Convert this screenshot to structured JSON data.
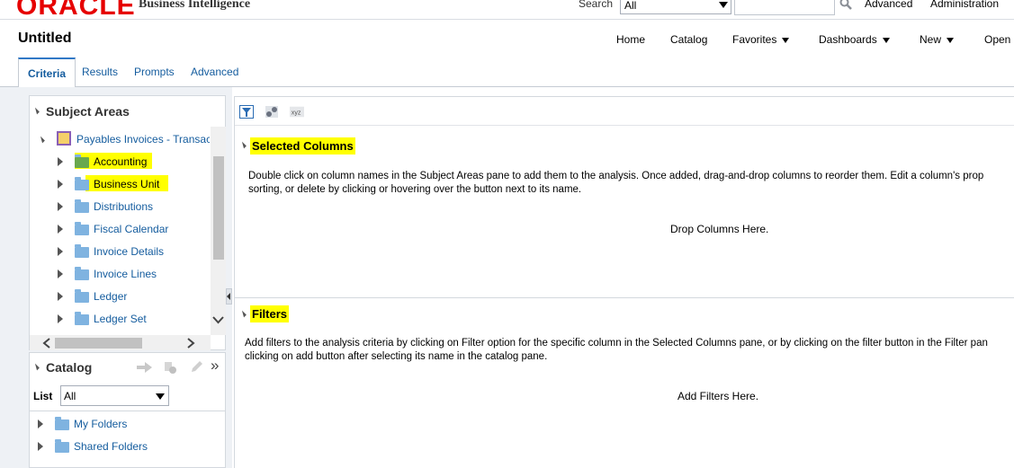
{
  "header": {
    "logo": "ORACLE",
    "product": "Business Intelligence",
    "search_label": "Search",
    "search_scope": "All",
    "search_value": "",
    "links": [
      "Advanced",
      "Administration"
    ]
  },
  "titlebar": {
    "title": "Untitled",
    "nav": [
      {
        "label": "Home",
        "dropdown": false
      },
      {
        "label": "Catalog",
        "dropdown": false
      },
      {
        "label": "Favorites",
        "dropdown": true
      },
      {
        "label": "Dashboards",
        "dropdown": true
      },
      {
        "label": "New",
        "dropdown": true
      },
      {
        "label": "Open",
        "dropdown": false
      }
    ]
  },
  "tabs": [
    {
      "label": "Criteria",
      "active": true
    },
    {
      "label": "Results",
      "active": false
    },
    {
      "label": "Prompts",
      "active": false
    },
    {
      "label": "Advanced",
      "active": false
    }
  ],
  "subject_areas": {
    "title": "Subject Areas",
    "root": "Payables Invoices - Transac",
    "items": [
      {
        "label": "Accounting",
        "highlighted": true
      },
      {
        "label": "Business Unit",
        "highlighted": true
      },
      {
        "label": "Distributions",
        "highlighted": false
      },
      {
        "label": "Fiscal Calendar",
        "highlighted": false
      },
      {
        "label": "Invoice Details",
        "highlighted": false
      },
      {
        "label": "Invoice Lines",
        "highlighted": false
      },
      {
        "label": "Ledger",
        "highlighted": false
      },
      {
        "label": "Ledger Set",
        "highlighted": false
      }
    ]
  },
  "catalog": {
    "title": "Catalog",
    "list_label": "List",
    "list_value": "All",
    "items": [
      "My Folders",
      "Shared Folders"
    ]
  },
  "selected_columns": {
    "title": "Selected Columns",
    "description_line1": "Double click on column names in the Subject Areas pane to add them to the analysis. Once added, drag-and-drop columns to reorder them. Edit a column's prop",
    "description_line2": "sorting, or delete by clicking or hovering over the button next to its name.",
    "drop_text": "Drop Columns Here."
  },
  "filters": {
    "title": "Filters",
    "description_line1": "Add filters to the analysis criteria by clicking on Filter option for the specific column in the Selected Columns pane, or by clicking on the filter button in the Filter pan",
    "description_line2": "clicking on add button after selecting its name in the catalog pane.",
    "drop_text": "Add Filters Here."
  },
  "colors": {
    "accent": "#145c9e",
    "highlight": "#ffff00",
    "logo_red": "#e60000",
    "folder_blue": "#7fb3e0"
  }
}
